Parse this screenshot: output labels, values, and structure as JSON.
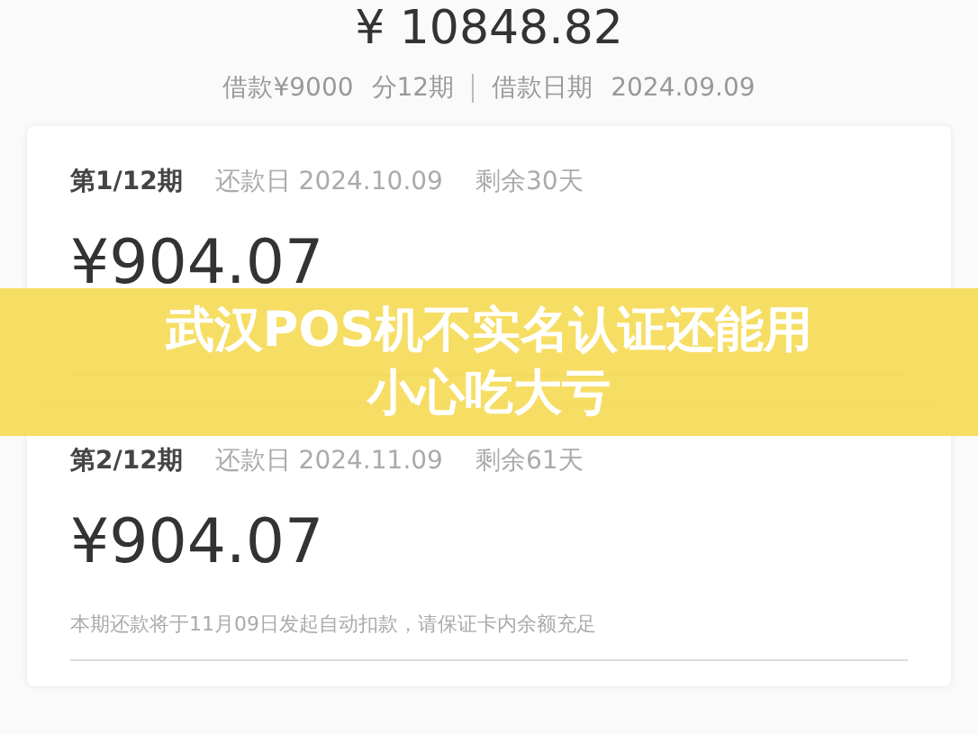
{
  "total": "¥ 10848.82",
  "summary": {
    "loan": "借款¥9000",
    "periods": "分12期",
    "date_label": "借款日期",
    "date": "2024.09.09"
  },
  "installments": [
    {
      "period": "第1/12期",
      "due": "还款日 2024.10.09",
      "remaining": "剩余30天",
      "amount": "¥904.07"
    },
    {
      "period": "第2/12期",
      "due": "还款日 2024.11.09",
      "remaining": "剩余61天",
      "amount": "¥904.07",
      "note": "本期还款将于11月09日发起自动扣款，请保证卡内余额充足"
    }
  ],
  "banner": {
    "lines": [
      "武汉POS机不实名认证还能用",
      "小心吃大亏"
    ]
  }
}
